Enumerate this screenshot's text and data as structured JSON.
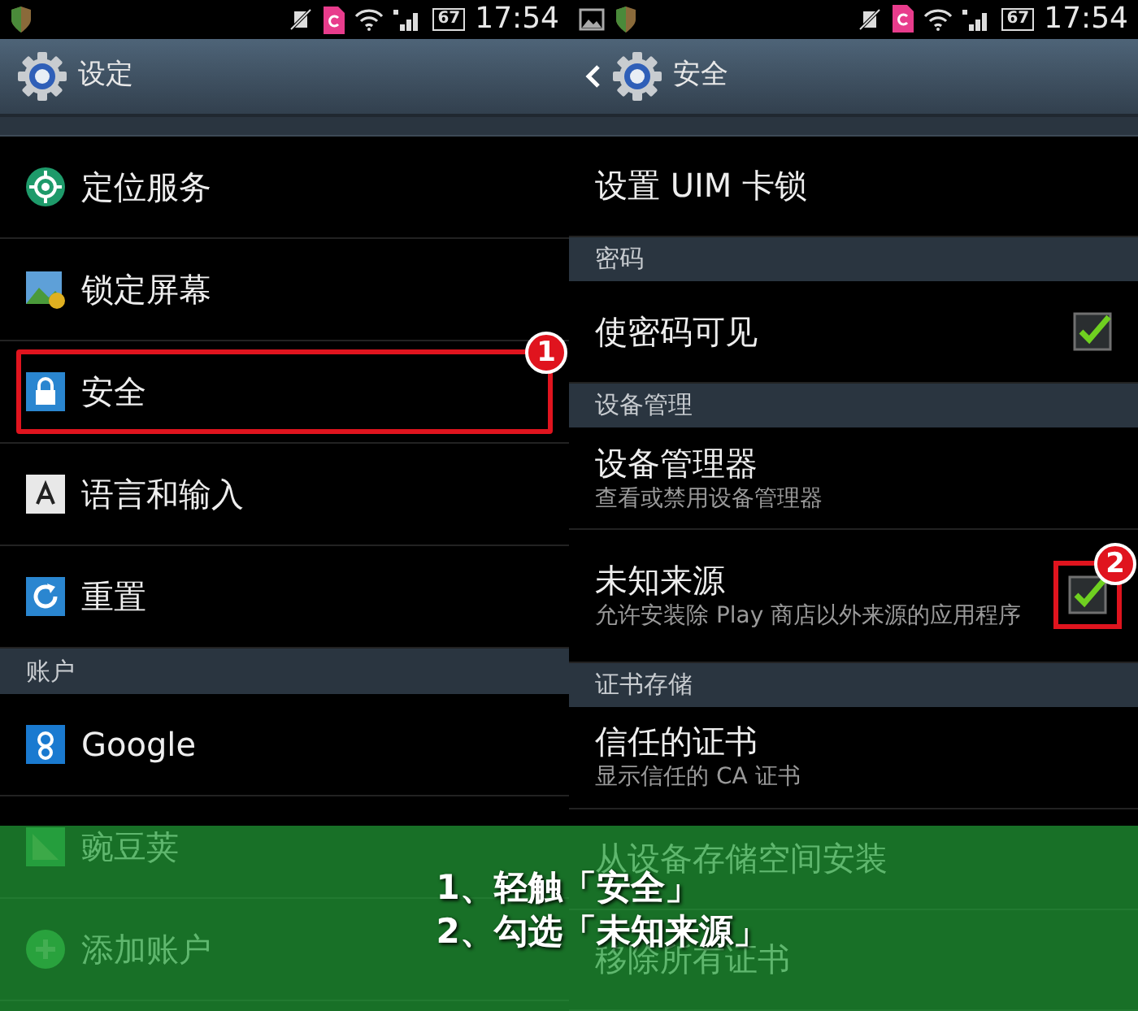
{
  "panes": [
    {
      "status_bar": {
        "battery": "67",
        "time": "17:54"
      },
      "header": {
        "title": "设定",
        "back": false
      },
      "rows": [
        {
          "kind": "stub"
        },
        {
          "kind": "item",
          "title": "定位服务",
          "highlighted": false
        },
        {
          "kind": "item",
          "title": "锁定屏幕",
          "highlighted": false
        },
        {
          "kind": "item",
          "title": "安全",
          "highlighted": true,
          "marker": "1"
        },
        {
          "kind": "item",
          "title": "语言和输入",
          "highlighted": false
        },
        {
          "kind": "item",
          "title": "重置",
          "highlighted": false
        },
        {
          "kind": "section",
          "title": "账户"
        },
        {
          "kind": "item",
          "title": "Google",
          "highlighted": false
        },
        {
          "kind": "item",
          "title": "豌豆荚",
          "highlighted": false
        },
        {
          "kind": "item",
          "title": "添加账户",
          "highlighted": false
        }
      ]
    },
    {
      "status_bar": {
        "battery": "67",
        "time": "17:54"
      },
      "header": {
        "title": "安全",
        "back": true
      },
      "rows": [
        {
          "kind": "stub"
        },
        {
          "kind": "item",
          "title": "设置 UIM 卡锁",
          "highlighted": false
        },
        {
          "kind": "section",
          "title": "密码"
        },
        {
          "kind": "check",
          "title": "使密码可见",
          "checked": true,
          "highlighted": false
        },
        {
          "kind": "section",
          "title": "设备管理"
        },
        {
          "kind": "item",
          "title": "设备管理器",
          "subtitle": "查看或禁用设备管理器",
          "highlighted": false
        },
        {
          "kind": "check",
          "title": "未知来源",
          "subtitle": "允许安装除 Play 商店以外来源的应用程序",
          "checked": true,
          "highlighted": true,
          "marker": "2"
        },
        {
          "kind": "section",
          "title": "证书存储"
        },
        {
          "kind": "item",
          "title": "信任的证书",
          "subtitle": "显示信任的 CA 证书",
          "highlighted": false
        },
        {
          "kind": "item",
          "title": "从设备存储空间安装",
          "highlighted": false
        },
        {
          "kind": "item",
          "title": "移除所有证书",
          "highlighted": false
        }
      ]
    }
  ],
  "caption": [
    "1、轻触「安全」",
    "2、勾选「未知来源」"
  ]
}
